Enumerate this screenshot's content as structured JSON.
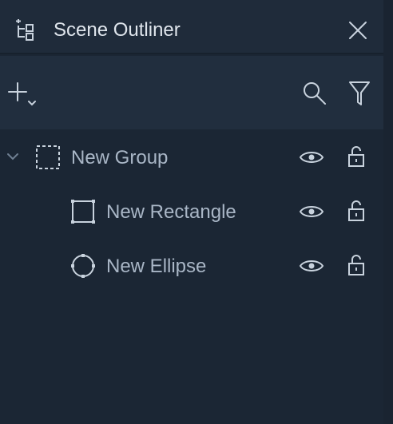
{
  "header": {
    "title": "Scene Outliner",
    "icon": "scene-tree-icon",
    "close_icon": "close-icon"
  },
  "toolbar": {
    "add_icon": "plus-dropdown-icon",
    "search_icon": "search-icon",
    "filter_icon": "filter-icon"
  },
  "tree": [
    {
      "label": "New Group",
      "type": "group",
      "expanded": true,
      "visible": true,
      "locked": false
    },
    {
      "label": "New Rectangle",
      "type": "rectangle",
      "visible": true,
      "locked": false
    },
    {
      "label": "New Ellipse",
      "type": "ellipse",
      "visible": true,
      "locked": false
    }
  ],
  "colors": {
    "panel_bg": "#1b2634",
    "header_bg": "#1f2b3a",
    "toolbar_bg": "#212e3e",
    "title_text": "#dfe5ec",
    "item_text": "#a9b6c6",
    "icon": "#c8d2dd"
  }
}
